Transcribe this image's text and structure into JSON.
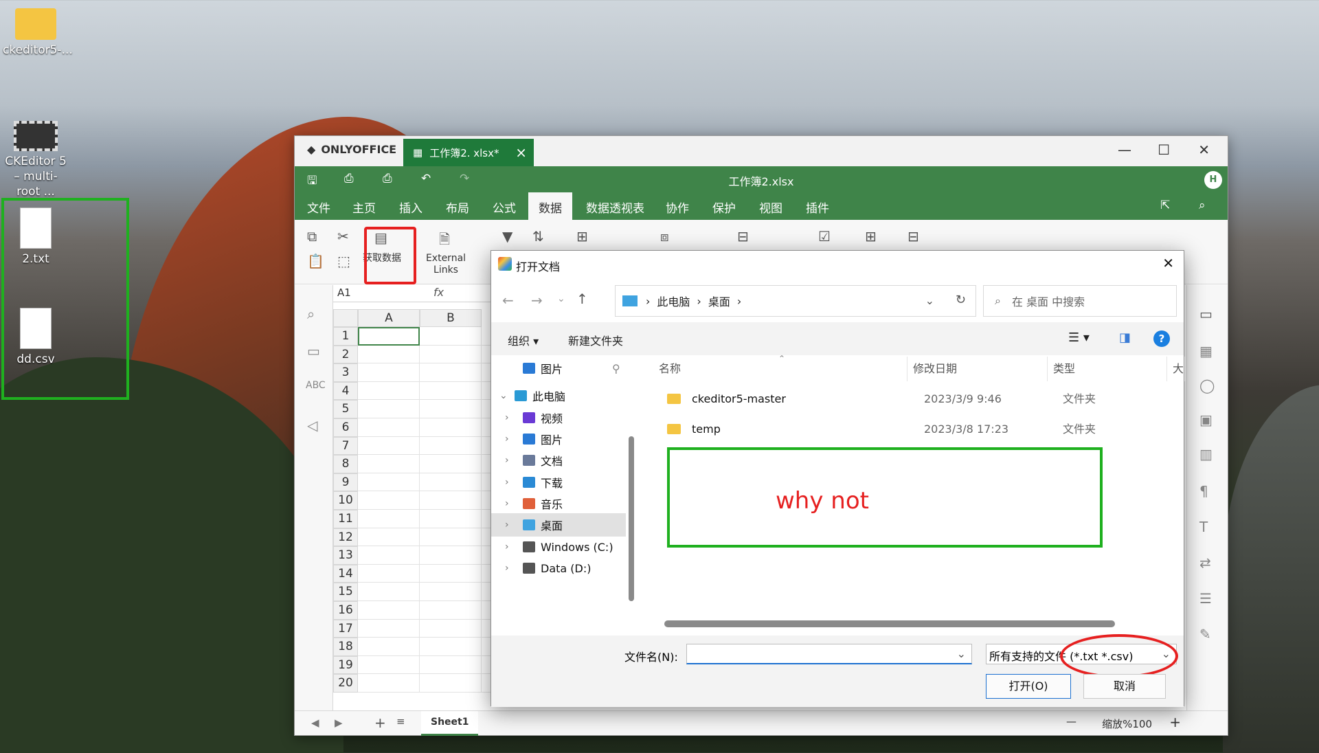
{
  "desktop": {
    "icons": [
      {
        "label": "ckeditor5-..."
      },
      {
        "label": "CKEditor 5 – multi-root ..."
      },
      {
        "label": "2.txt"
      },
      {
        "label": "dd.csv"
      }
    ]
  },
  "app": {
    "brand": "ONLYOFFICE",
    "tab_title": "工作簿2. xlsx*",
    "doc_title": "工作簿2.xlsx",
    "avatar": "H",
    "menu": [
      "文件",
      "主页",
      "插入",
      "布局",
      "公式",
      "数据",
      "数据透视表",
      "协作",
      "保护",
      "视图",
      "插件"
    ],
    "active_menu": "数据",
    "toolbar": {
      "get_data": "获取数据",
      "external_links": "External Links"
    },
    "name_box": "A1",
    "fx": "fx",
    "columns": [
      "A",
      "B"
    ],
    "rows": [
      "1",
      "2",
      "3",
      "4",
      "5",
      "6",
      "7",
      "8",
      "9",
      "10",
      "11",
      "12",
      "13",
      "14",
      "15",
      "16",
      "17",
      "18",
      "19",
      "20"
    ],
    "sheet_tab": "Sheet1",
    "zoom": "缩放%100"
  },
  "dialog": {
    "title": "打开文档",
    "breadcrumb": [
      "此电脑",
      "桌面"
    ],
    "search_placeholder": "在 桌面 中搜索",
    "organize": "组织",
    "new_folder": "新建文件夹",
    "nav": [
      {
        "label": "图片",
        "icon": "pictures-icon"
      },
      {
        "label": "此电脑",
        "icon": "computer-icon"
      },
      {
        "label": "视频",
        "icon": "video-icon"
      },
      {
        "label": "图片",
        "icon": "pictures-icon"
      },
      {
        "label": "文档",
        "icon": "documents-icon"
      },
      {
        "label": "下载",
        "icon": "download-icon"
      },
      {
        "label": "音乐",
        "icon": "music-icon"
      },
      {
        "label": "桌面",
        "icon": "desktop-icon"
      },
      {
        "label": "Windows (C:)",
        "icon": "drive-icon"
      },
      {
        "label": "Data (D:)",
        "icon": "drive-icon"
      }
    ],
    "columns": [
      "名称",
      "修改日期",
      "类型",
      "大小"
    ],
    "files": [
      {
        "name": "ckeditor5-master",
        "date": "2023/3/9 9:46",
        "type": "文件夹"
      },
      {
        "name": "temp",
        "date": "2023/3/8 17:23",
        "type": "文件夹"
      }
    ],
    "annotation": "why not",
    "filename_label": "文件名(N):",
    "filename_value": "",
    "filter": "所有支持的文件 (*.txt *.csv)",
    "open_button": "打开(O)",
    "cancel_button": "取消"
  },
  "colors": {
    "oo_green": "#3f8449",
    "annotation_red": "#e62020",
    "annotation_green": "#1fb01f"
  }
}
